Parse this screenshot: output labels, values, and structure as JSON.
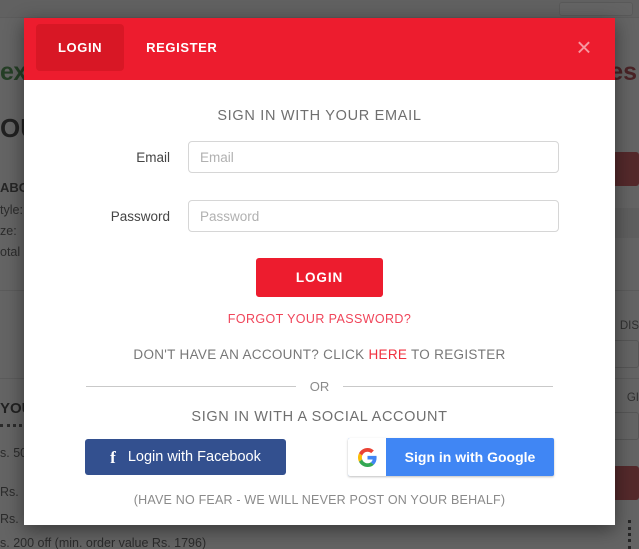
{
  "background": {
    "logo_left": "ex",
    "logo_right": "es",
    "heading": "OU",
    "sub_heading": "ABO",
    "detail_lines": [
      "tyle:",
      "ze: ",
      "otal "
    ],
    "your_label": "YOU",
    "prices": [
      "s. 50",
      "Rs. ",
      "Rs. "
    ],
    "promo": "s. 200 off (min. order value Rs. 1796)",
    "right_labels": [
      "DIS",
      "GI"
    ]
  },
  "modal": {
    "tabs": [
      {
        "label": "LOGIN",
        "active": true
      },
      {
        "label": "REGISTER",
        "active": false
      }
    ],
    "close_icon": "close-icon",
    "close_glyph": "×",
    "email_section_title": "SIGN IN WITH YOUR EMAIL",
    "fields": [
      {
        "label": "Email",
        "placeholder": "Email",
        "value": ""
      },
      {
        "label": "Password",
        "placeholder": "Password",
        "value": ""
      }
    ],
    "login_button": "LOGIN",
    "forgot_password": "FORGOT YOUR PASSWORD?",
    "register_prompt_before": "DON'T HAVE AN ACCOUNT? CLICK ",
    "register_prompt_link": "HERE",
    "register_prompt_after": " TO REGISTER",
    "or_text": "OR",
    "social_section_title": "SIGN IN WITH A SOCIAL ACCOUNT",
    "facebook_button": "Login with Facebook",
    "google_button": "Sign in with Google",
    "social_note": "(HAVE NO FEAR - WE WILL NEVER POST ON YOUR BEHALF)"
  },
  "colors": {
    "header_red": "#ed1c2e",
    "active_tab_red": "#d81725",
    "link_red": "#f0303f",
    "facebook_blue": "#33508f",
    "google_blue": "#4086f4",
    "label_grey": "#6f6f6f"
  }
}
